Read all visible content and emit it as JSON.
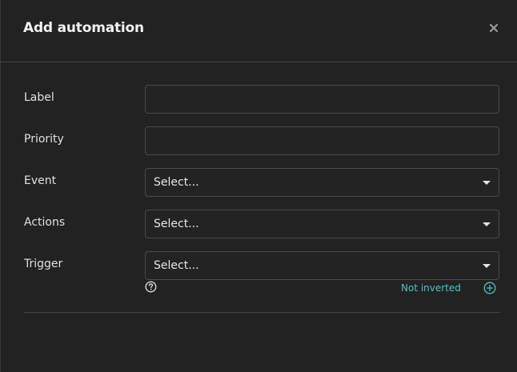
{
  "modal": {
    "title": "Add automation",
    "close_icon": "close-icon"
  },
  "form": {
    "label": {
      "label": "Label",
      "value": "",
      "placeholder": ""
    },
    "priority": {
      "label": "Priority",
      "value": "",
      "placeholder": ""
    },
    "event": {
      "label": "Event",
      "selected": "Select..."
    },
    "actions": {
      "label": "Actions",
      "selected": "Select..."
    },
    "trigger": {
      "label": "Trigger",
      "selected": "Select...",
      "help_icon": "question-circle-icon",
      "inversion_status": "Not inverted",
      "add_icon": "plus-circle-icon"
    }
  },
  "colors": {
    "background": "#222222",
    "border": "#4a4a4a",
    "accent": "#4fc3c8",
    "text": "#e6e6e6"
  }
}
